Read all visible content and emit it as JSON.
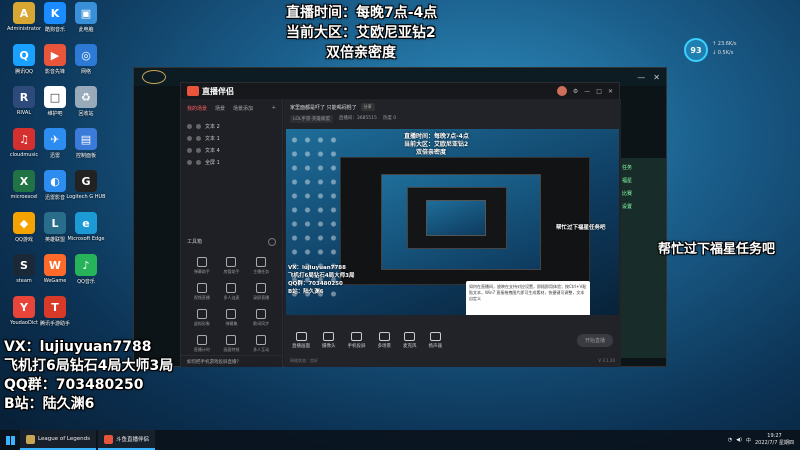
{
  "desktop": {
    "icons": [
      {
        "label": "Administrator",
        "color": "#d8a733",
        "glyph": "A"
      },
      {
        "label": "酷狗音乐",
        "color": "#1a8cff",
        "glyph": "K"
      },
      {
        "label": "此电脑",
        "color": "#3a8fd9",
        "glyph": "▣"
      },
      {
        "label": "腾讯QQ",
        "color": "#1aa0ff",
        "glyph": "Q"
      },
      {
        "label": "影音先锋",
        "color": "#e8553a",
        "glyph": "▶"
      },
      {
        "label": "网络",
        "color": "#2c7ad6",
        "glyph": "◎"
      },
      {
        "label": "RIVAL",
        "color": "#2e4a7a",
        "glyph": "R"
      },
      {
        "label": "维护吧",
        "color": "#ffffff",
        "glyph": "□"
      },
      {
        "label": "回收站",
        "color": "#9ab",
        "glyph": "♻"
      },
      {
        "label": "cloudmusic",
        "color": "#d3302f",
        "glyph": "♫"
      },
      {
        "label": "迅雷",
        "color": "#2d8cf0",
        "glyph": "✈"
      },
      {
        "label": "控制面板",
        "color": "#3b7ad9",
        "glyph": "▤"
      },
      {
        "label": "microexcel",
        "color": "#217346",
        "glyph": "X"
      },
      {
        "label": "迅雷影音",
        "color": "#2d8cf0",
        "glyph": "◐"
      },
      {
        "label": "Logitech G HUB",
        "color": "#222",
        "glyph": "G"
      },
      {
        "label": "QQ游戏",
        "color": "#f4a300",
        "glyph": "◆"
      },
      {
        "label": "英雄联盟",
        "color": "#2a6d8a",
        "glyph": "L"
      },
      {
        "label": "Microsoft Edge",
        "color": "#1c9ad6",
        "glyph": "e"
      },
      {
        "label": "steam",
        "color": "#1b2838",
        "glyph": "S"
      },
      {
        "label": "WeGame",
        "color": "#ff6a2a",
        "glyph": "W"
      },
      {
        "label": "QQ音乐",
        "color": "#27b35a",
        "glyph": "♪"
      },
      {
        "label": "YoudaoDict",
        "color": "#e8453a",
        "glyph": "Y"
      },
      {
        "label": "腾讯手游助手",
        "color": "#d83a2a",
        "glyph": "T"
      }
    ]
  },
  "overlay": {
    "time_line": "直播时间：每晚7点-4点",
    "region_line": "当前大区：艾欧尼亚钻2",
    "double_line": "双倍亲密度",
    "help_line": "帮忙过下福星任务吧",
    "vx_line": "VX：lujiuyuan7788",
    "fly_line": "飞机打6局钻石4局大师3局",
    "qq_line": "QQ群：703480250",
    "b_line": "B站：陆久渊6"
  },
  "app": {
    "title": "直播伴侣",
    "tabs": [
      "我的场景",
      "场景",
      "场景添加"
    ],
    "active_tab": 0,
    "scenes": [
      "文本 2",
      "文本 1",
      "文本 4",
      "全屏 1"
    ],
    "tools_header": "工具箱",
    "tools": [
      "弹幕助手",
      "房管助手",
      "主播任务",
      "视频直播",
      "多人连麦",
      "录屏直播",
      "虚拟形象",
      "弹幕集",
      "歌词同步",
      "直播计时",
      "画面特效",
      "多人互动"
    ],
    "hint": "如何把手机游戏投屏直播？",
    "room_title": "家里面都是吓了 只能喝闷棍了",
    "room_tag": "分享",
    "meta": [
      "LOL手游·英雄联盟",
      "直播间：3685515",
      "热度 0"
    ],
    "bottom_tools": [
      "直播画面",
      "摄像头",
      "手机投屏",
      "多场景",
      "麦克风",
      "扬声器"
    ],
    "start_button": "开始直播",
    "footer_left": "网络状态：良好",
    "version": "V 3.1.20"
  },
  "preview": {
    "time_line": "直播时间：每晚7点-4点",
    "region_line": "当前大区：艾欧尼亚钻2",
    "double_line": "双倍亲密度",
    "help_line": "帮忙过下福星任务吧",
    "vx_line": "VX：lujiuyuan7788",
    "fly_line": "飞机打6局钻石4局大师3局",
    "qq_line": "QQ群：703480250",
    "b_line": "B站：陆久渊6",
    "popup_text": "如何在直播间，放映在支持对应设置，即插即用体验；按Ctrl+V粘贴文本，Win7 直接拖拽图片即可生成素材，快捷键可调整，文本自定义"
  },
  "bg_window": {
    "side_rows": [
      "任务",
      "福星",
      "比赛",
      "设置"
    ]
  },
  "widget": {
    "badge": "93",
    "line1": "↑ 23.6K/s",
    "line2": "↓ 0.5K/s"
  },
  "taskbar": {
    "tasks": [
      {
        "label": "League of Legends",
        "color": "#c8a654"
      },
      {
        "label": "斗鱼直播伴侣",
        "color": "#e8553a"
      }
    ],
    "time": "19:27",
    "date": "2022/7/7 星期四"
  }
}
